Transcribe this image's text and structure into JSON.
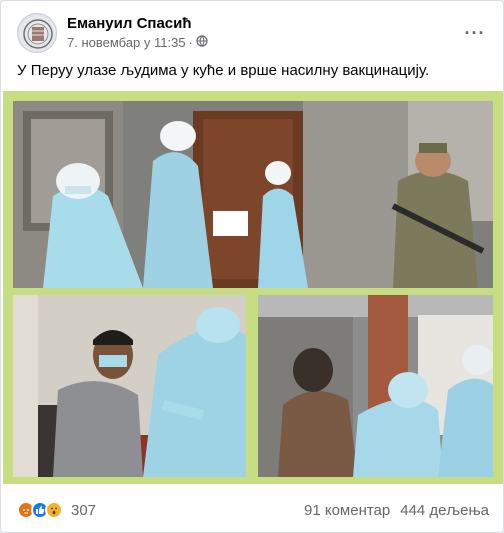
{
  "post": {
    "author": "Емануил Спасић",
    "timestamp": "7. новембар у 11:35",
    "privacy_icon": "globe-icon",
    "more_icon": "ellipsis-icon",
    "text": "У Перуу улазе људима у куће и врше насилну вакцинацију.",
    "more_label": "···"
  },
  "footer": {
    "reaction_icons": [
      "angry-reaction-icon",
      "like-reaction-icon",
      "wow-reaction-icon"
    ],
    "reaction_count": "307",
    "comments": "91 коментар",
    "shares": "444 дељења"
  },
  "colors": {
    "collage_border": "#c6dd82",
    "ppe_blue": "#9fd3e6",
    "secondary_text": "#65676b"
  }
}
